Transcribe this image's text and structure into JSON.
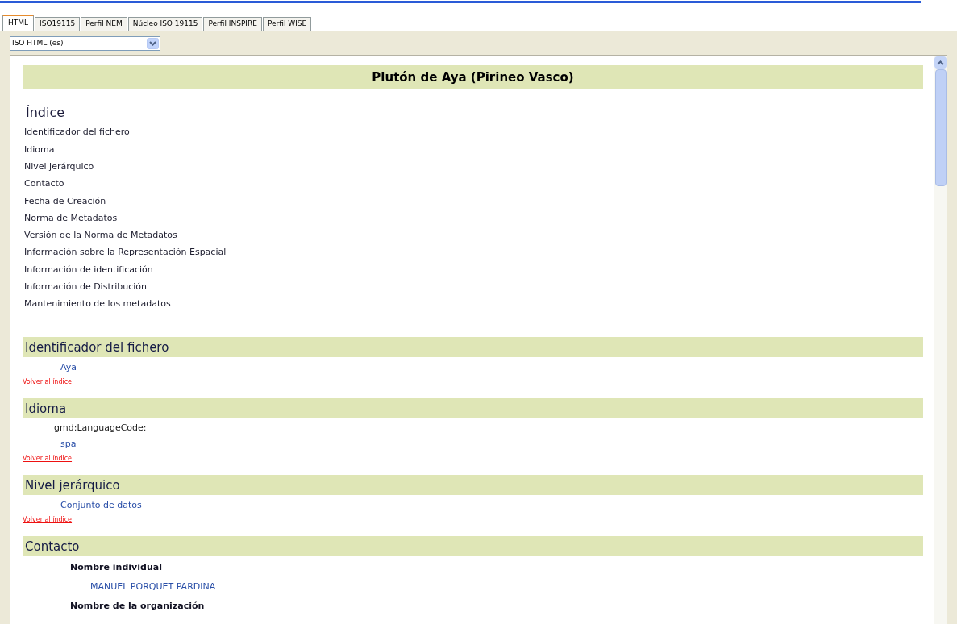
{
  "tabs": [
    {
      "label": "HTML",
      "selected": true
    },
    {
      "label": "ISO19115",
      "selected": false
    },
    {
      "label": "Perfil NEM",
      "selected": false
    },
    {
      "label": "Núcleo ISO 19115",
      "selected": false
    },
    {
      "label": "Perfil INSPIRE",
      "selected": false
    },
    {
      "label": "Perfil WISE",
      "selected": false
    }
  ],
  "format_select": {
    "value": "ISO HTML (es)"
  },
  "document": {
    "title": "Plutón de Aya (Pirineo Vasco)",
    "index": {
      "heading": "Índice",
      "items": [
        "Identificador del fichero",
        "Idioma",
        "Nivel jerárquico",
        "Contacto",
        "Fecha de Creación",
        "Norma de Metadatos",
        "Versión de la Norma de Metadatos",
        "Información sobre la Representación Espacial",
        "Información de identificación",
        "Información de Distribución",
        "Mantenimiento de los metadatos"
      ]
    },
    "sections": [
      {
        "heading": "Identificador del fichero",
        "entries": [
          {
            "kind": "value",
            "text": "Aya"
          }
        ],
        "back_link": "Volver al índice"
      },
      {
        "heading": "Idioma",
        "entries": [
          {
            "kind": "code",
            "text": "gmd:LanguageCode:"
          },
          {
            "kind": "value",
            "text": "spa"
          }
        ],
        "back_link": "Volver al índice"
      },
      {
        "heading": "Nivel jerárquico",
        "entries": [
          {
            "kind": "value",
            "text": "Conjunto de datos"
          }
        ],
        "back_link": "Volver al índice"
      },
      {
        "heading": "Contacto",
        "entries": [
          {
            "kind": "field",
            "text": "Nombre individual"
          },
          {
            "kind": "subvalue",
            "text": "MANUEL PORQUET PARDINA"
          },
          {
            "kind": "field",
            "text": "Nombre de la organización"
          }
        ]
      }
    ]
  }
}
